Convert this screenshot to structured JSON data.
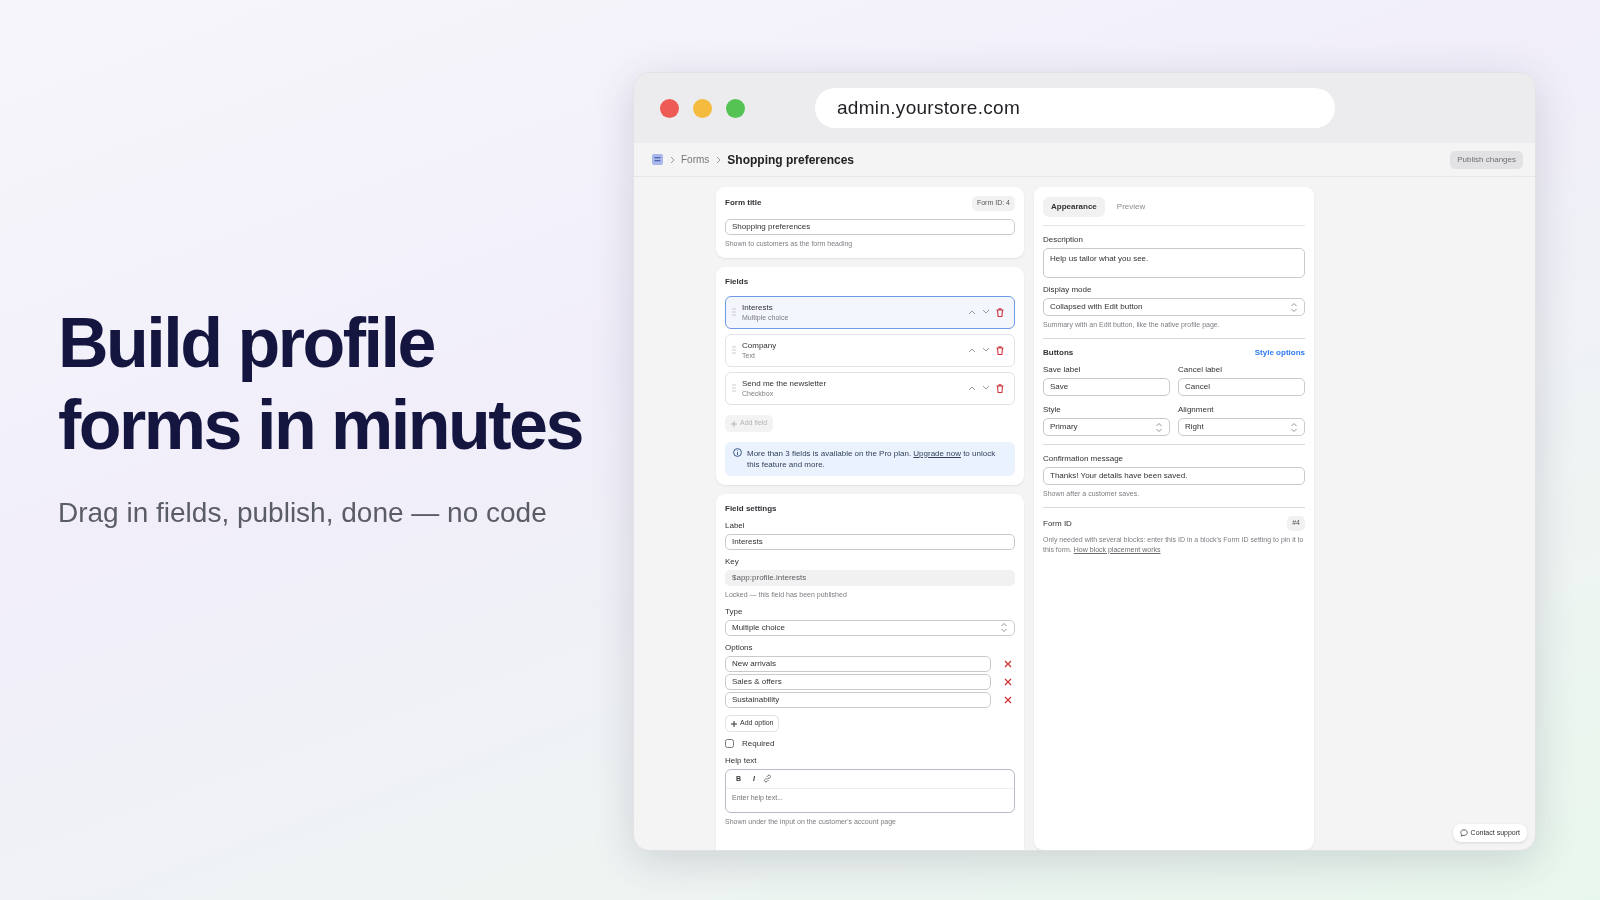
{
  "hero": {
    "title": "Build profile forms in minutes",
    "subtitle": "Drag in fields, publish, done — no code"
  },
  "browser": {
    "url": "admin.yourstore.com"
  },
  "breadcrumb": {
    "items": [
      "Forms",
      "Shopping preferences"
    ]
  },
  "publish_button": {
    "label": "Publish changes",
    "disabled": true
  },
  "form_title": {
    "label": "Form title",
    "badge": "Form ID: 4",
    "value": "Shopping preferences",
    "help": "Shown to customers as the form heading"
  },
  "fields": {
    "heading": "Fields",
    "items": [
      {
        "name": "Interests",
        "type": "Multiple choice",
        "selected": true
      },
      {
        "name": "Company",
        "type": "Text",
        "selected": false
      },
      {
        "name": "Send me the newsletter",
        "type": "Checkbox",
        "selected": false
      }
    ],
    "add_field": {
      "label": "Add field",
      "disabled": true
    },
    "notice": {
      "text": "More than 3 fields is available on the Pro plan.",
      "link": "Upgrade now",
      "after": "to unlock this feature and more."
    }
  },
  "field_settings": {
    "heading": "Field settings",
    "label_field": {
      "label": "Label",
      "value": "Interests"
    },
    "key": {
      "label": "Key",
      "value": "$app:profile.interests",
      "disabled": true,
      "help": "Locked — this field has been published"
    },
    "type": {
      "label": "Type",
      "value": "Multiple choice"
    },
    "options": {
      "label": "Options",
      "items": [
        "New arrivals",
        "Sales & offers",
        "Sustainability"
      ],
      "add": "Add option"
    },
    "required": {
      "label": "Required",
      "checked": false
    },
    "help_text": {
      "label": "Help text",
      "toolbar": [
        "B",
        "I"
      ],
      "placeholder": "Enter help text...",
      "help": "Shown under the input on the customer's account page"
    }
  },
  "panel": {
    "tabs": [
      {
        "label": "Appearance",
        "selected": true
      },
      {
        "label": "Preview",
        "selected": false
      }
    ],
    "description": {
      "label": "Description",
      "value": "Help us tailor what you see."
    },
    "display_mode": {
      "label": "Display mode",
      "value": "Collapsed with Edit button",
      "help": "Summary with an Edit button, like the native profile page."
    },
    "buttons": {
      "heading": "Buttons",
      "link": "Style options",
      "save_label": {
        "label": "Save label",
        "value": "Save"
      },
      "cancel_label": {
        "label": "Cancel label",
        "value": "Cancel"
      },
      "style": {
        "label": "Style",
        "value": "Primary"
      },
      "alignment": {
        "label": "Alignment",
        "value": "Right"
      }
    },
    "confirmation": {
      "label": "Confirmation message",
      "value": "Thanks! Your details have been saved.",
      "help": "Shown after a customer saves."
    },
    "form_id": {
      "label": "Form ID",
      "badge": "#4",
      "text": "Only needed with several blocks: enter this ID in a block's Form ID setting to pin it to this form.",
      "link": "How block placement works"
    }
  },
  "contact_support": {
    "label": "Contact support"
  }
}
